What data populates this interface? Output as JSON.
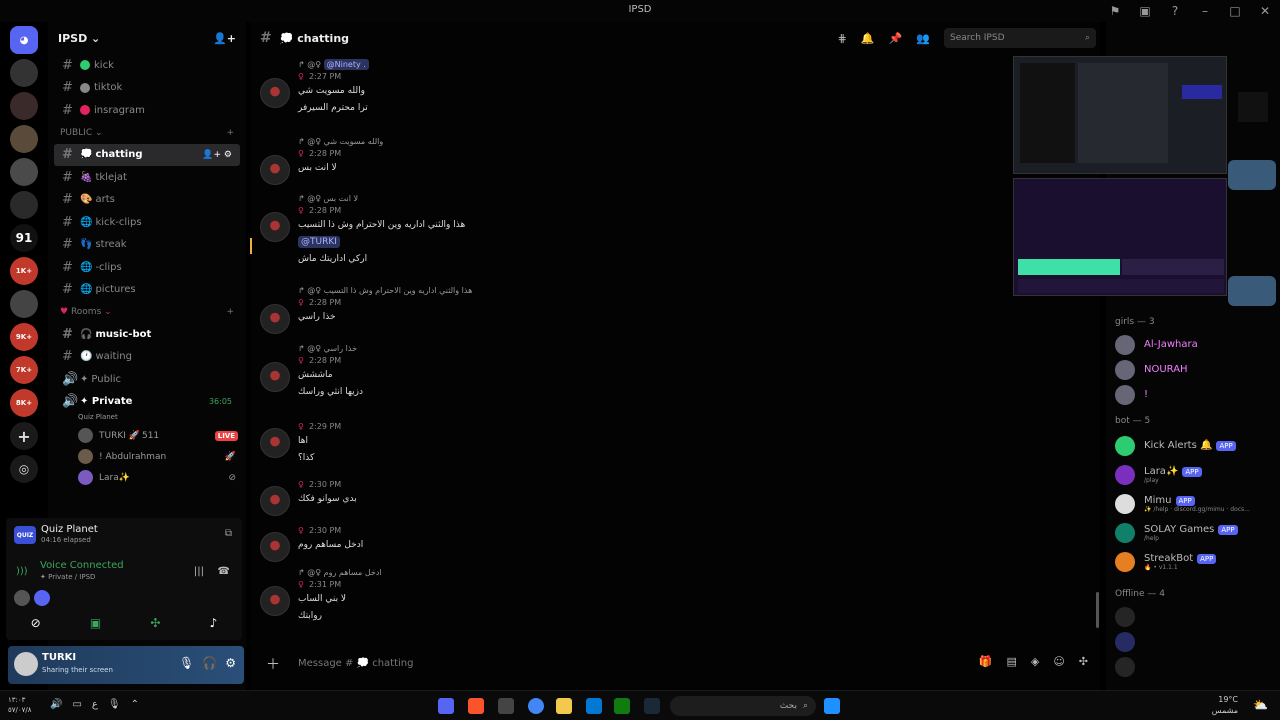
{
  "window": {
    "title": "IPSD"
  },
  "server": {
    "name": "IPSD"
  },
  "channels_top": [
    {
      "name": "kick",
      "dot": "#2ecc71"
    },
    {
      "name": "tiktok",
      "dot": "#888888"
    },
    {
      "name": "insragram",
      "dot": "#e0245e"
    }
  ],
  "public_label": "PUBLIC",
  "channels_public": [
    {
      "name": "chatting",
      "prefix": "💭"
    },
    {
      "name": "tklejat",
      "prefix": "🍇"
    },
    {
      "name": "arts",
      "prefix": "🎨"
    },
    {
      "name": "kick-clips",
      "prefix": "🌐"
    },
    {
      "name": "streak",
      "prefix": "👣"
    },
    {
      "name": "-clips",
      "prefix": "🌐"
    },
    {
      "name": "pictures",
      "prefix": "🌐"
    }
  ],
  "rooms_label": "Rooms",
  "rooms": [
    {
      "name": "music-bot",
      "prefix": "🎧"
    },
    {
      "name": "waiting",
      "prefix": "🕐"
    },
    {
      "name": "Public",
      "prefix": "✦"
    }
  ],
  "private_room": {
    "name": "Private",
    "prefix": "✦",
    "timer": "36:05",
    "activity": "Quiz Planet"
  },
  "voice_users": [
    {
      "name": "TURKI",
      "extra": "511",
      "live": "LIVE"
    },
    {
      "name": "! Abdulrahman"
    },
    {
      "name": "Lara✨"
    }
  ],
  "activity": {
    "name": "Quiz Planet",
    "elapsed": "04:16 elapsed",
    "logo": "QUIZ"
  },
  "voice": {
    "status": "Voice Connected",
    "channel": "✦ Private / IPSD"
  },
  "user": {
    "name": "TURKI",
    "status": "Sharing their screen"
  },
  "chat": {
    "channel": "chatting",
    "placeholder": "Message # 💭 chatting",
    "search": "Search IPSD"
  },
  "messages": [
    {
      "reply": "@Ninety .",
      "time": "2:27 PM",
      "lines": [
        "والله مسويت شي",
        "ترا محترم السيرفر"
      ]
    },
    {
      "reply": "والله مسويت شي",
      "time": "2:28 PM",
      "lines": [
        "لا انت بس"
      ]
    },
    {
      "reply": "لا انت بس",
      "time": "2:28 PM",
      "lines": [
        "هذا والثني اداريه وين الاحترام وش ذا التسيب",
        "@TURKI",
        "اركي اداريتك ماش"
      ]
    },
    {
      "reply": "هذا والثني اداريه وين الاحترام وش ذا التسيب",
      "time": "2:28 PM",
      "lines": [
        "خذا راسي"
      ]
    },
    {
      "reply": "خذا راسي",
      "time": "2:28 PM",
      "lines": [
        "ماششش",
        "دزيها انثي وراسك"
      ]
    },
    {
      "reply": "",
      "time": "2:29 PM",
      "lines": [
        "اها",
        "كذا؟"
      ]
    },
    {
      "reply": "",
      "time": "2:30 PM",
      "lines": [
        "بدي سوانو فكك"
      ]
    },
    {
      "reply": "",
      "time": "2:30 PM",
      "lines": [
        "ادخل مساهم روم"
      ]
    },
    {
      "reply": "ادخل مساهم روم",
      "time": "2:31 PM",
      "lines": [
        "لا بني الساب",
        "روابتك"
      ]
    }
  ],
  "members": {
    "girls_header": "girls — 3",
    "girls": [
      {
        "name": "Al-Jawhara",
        "color": "#f47fff"
      },
      {
        "name": "NOURAH",
        "color": "#f47fff"
      },
      {
        "name": "!",
        "color": "#f47fff"
      }
    ],
    "bot_header": "bot — 5",
    "bots": [
      {
        "name": "Kick Alerts 🔔",
        "sub": "",
        "badge": "APP",
        "color": "#2ecc71"
      },
      {
        "name": "Lara✨",
        "sub": "/play",
        "badge": "APP",
        "color": "#7b2fbe"
      },
      {
        "name": "Mimu",
        "sub": "✨ /help · discord.gg/mimu · docs...",
        "badge": "APP",
        "color": "#dddddd"
      },
      {
        "name": "SOLAY Games",
        "sub": "/help",
        "badge": "APP",
        "color": "#11806a"
      },
      {
        "name": "StreakBot",
        "sub": "🔥 • v1.1.1",
        "badge": "APP",
        "color": "#e67e22"
      }
    ],
    "offline_header": "Offline — 4"
  },
  "taskbar": {
    "time": "١٣:٠٣",
    "date": "٥٧/٠٧/٨",
    "weather": "19°C",
    "weather_desc": "مشمس",
    "search": "بحث",
    "lang": "ع"
  },
  "guild_badges": [
    "91",
    "1K+",
    "9K+",
    "7K+",
    "8K+"
  ]
}
